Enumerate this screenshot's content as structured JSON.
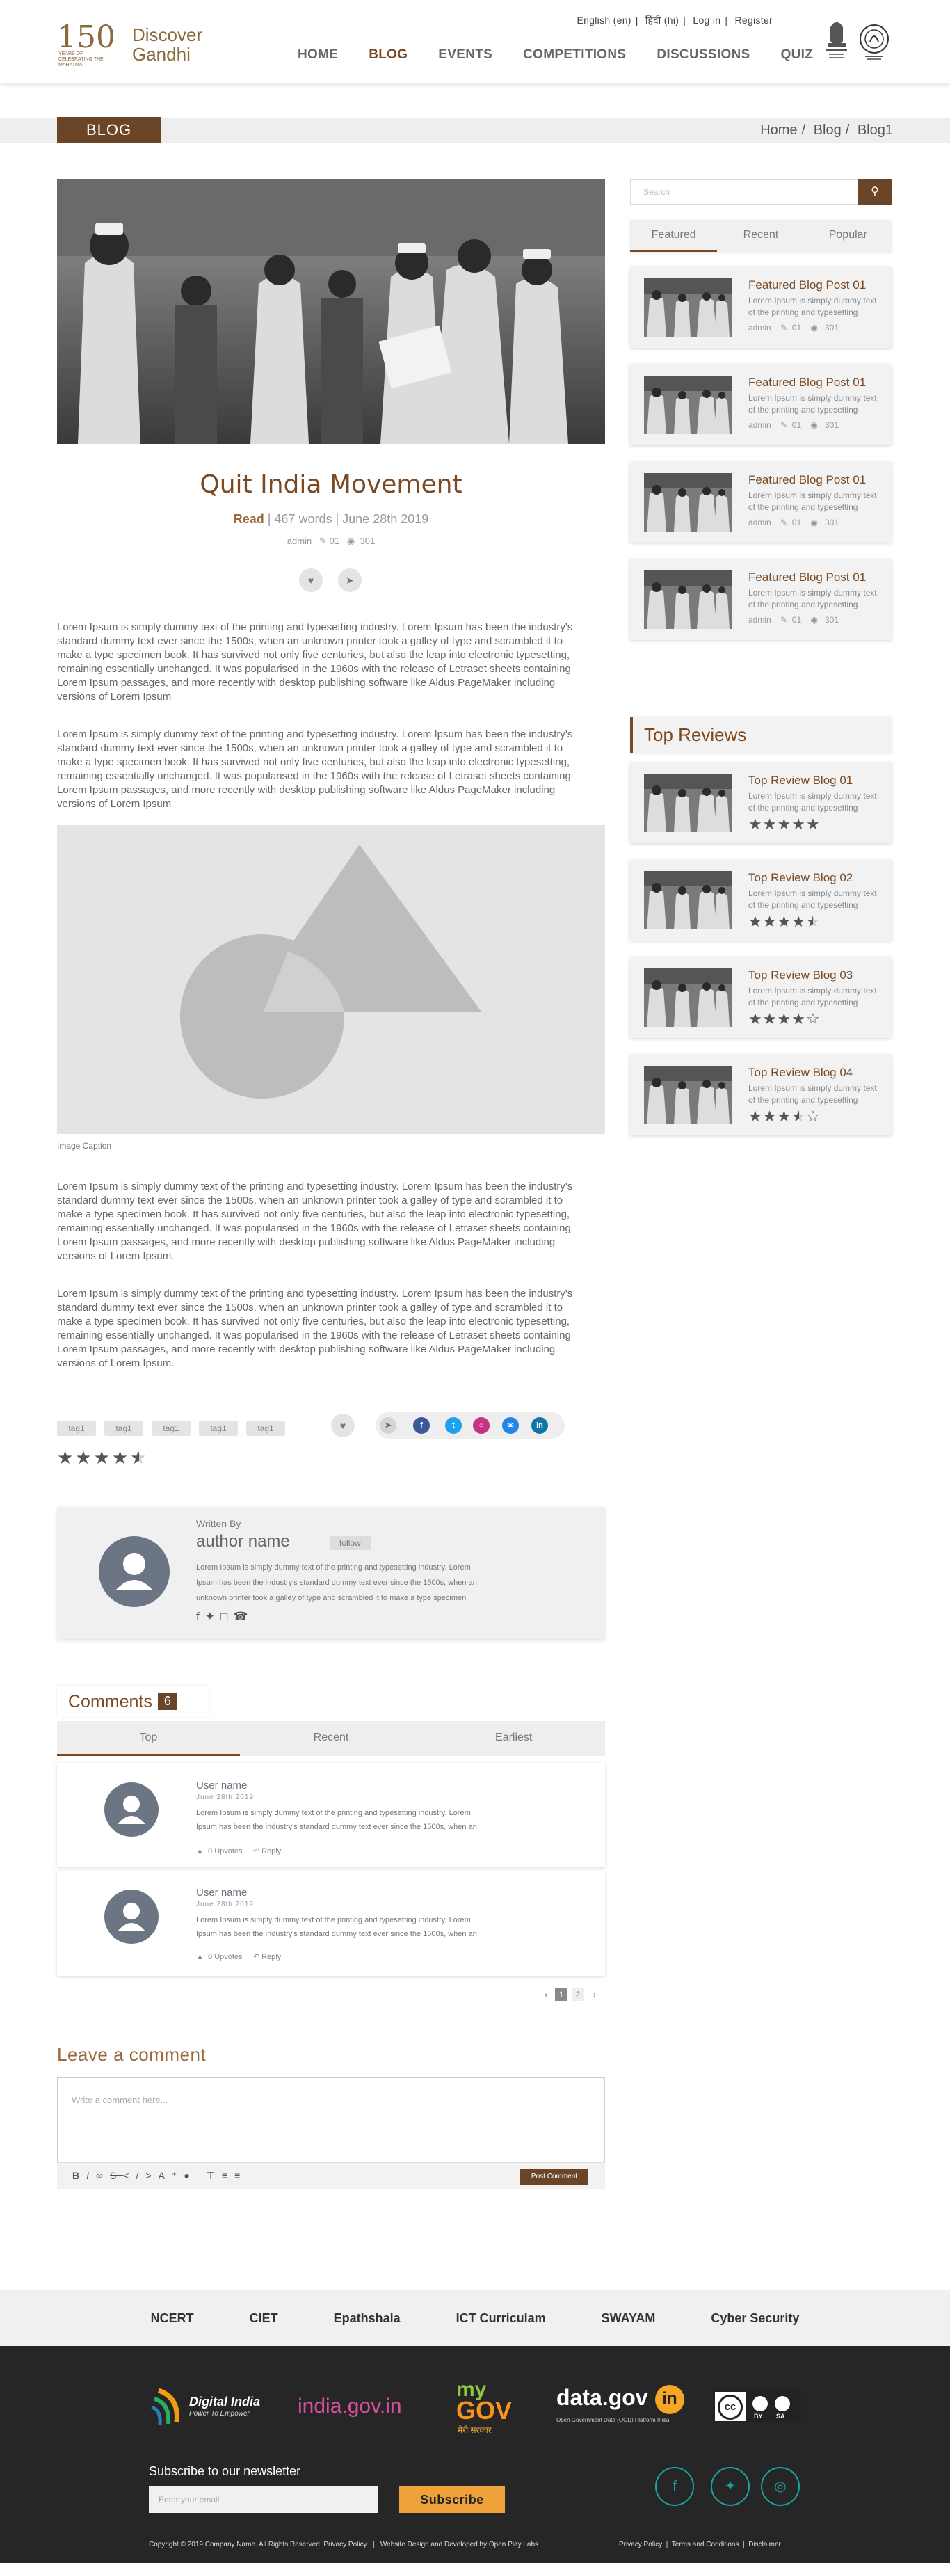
{
  "header": {
    "language_en": "English (en)",
    "language_hi": "हिंदी (hi)",
    "login": "Log in",
    "register": "Register",
    "logo_number": "150",
    "logo_small": "YEARS OF CELEBRATING THE MAHATMA",
    "logo_line1": "Discover",
    "logo_line2": "Gandhi",
    "nav": [
      "HOME",
      "BLOG",
      "EVENTS",
      "COMPETITIONS",
      "DISCUSSIONS",
      "QUIZ"
    ],
    "active_nav": "BLOG"
  },
  "banner": {
    "tag": "BLOG",
    "breadcrumb": [
      "Home",
      "Blog",
      "Blog1"
    ]
  },
  "article": {
    "title": "Quit India Movement",
    "read_label": "Read",
    "words": "467 words",
    "date": "June 28th 2019",
    "author": "admin",
    "comments": "01",
    "views": "301",
    "paragraph": "Lorem Ipsum is simply dummy text of the printing and typesetting industry. Lorem Ipsum has been the industry's standard dummy text ever since the 1500s, when an unknown printer took a galley of type and scrambled it to make a type specimen book. It has survived not only five centuries, but also the leap into electronic typesetting, remaining essentially unchanged. It was popularised in the 1960s with the release of Letraset sheets containing Lorem Ipsum passages, and more recently with desktop publishing software like Aldus PageMaker including versions of Lorem Ipsum",
    "paragraph_dot": "Lorem Ipsum is simply dummy text of the printing and typesetting industry. Lorem Ipsum has been the industry's standard dummy text ever since the 1500s, when an unknown printer took a galley of type and scrambled it to make a type specimen book. It has survived not only five centuries, but also the leap into electronic typesetting, remaining essentially unchanged. It was popularised in the 1960s with the release of Letraset sheets containing Lorem Ipsum passages, and more recently with desktop publishing software like Aldus PageMaker including versions of Lorem Ipsum.",
    "image_caption": "Image Caption",
    "tags": [
      "tag1",
      "tag1",
      "tag1",
      "tag1",
      "tag1"
    ],
    "rating": 4.5
  },
  "author_box": {
    "written_by": "Written By",
    "name": "author name",
    "follow": "follow",
    "bio_lines": [
      "Lorem Ipsum is simply dummy text of the printing and typesetting industry. Lorem",
      "Ipsum has been the industry's standard dummy text ever since the 1500s, when an",
      "unknown printer took a galley of type and scrambled it to make a type specimen"
    ]
  },
  "comments": {
    "heading": "Comments",
    "count": "6",
    "tabs": [
      "Top",
      "Recent",
      "Earliest"
    ],
    "items": [
      {
        "user": "User name",
        "date": "June 28th 2019",
        "text1": "Lorem Ipsum is simply dummy text of the printing and typesetting industry. Lorem",
        "text2": "Ipsum has been the industry's standard dummy text ever since the 1500s, when an",
        "upvotes": "0 Upvotes",
        "reply": "Reply"
      },
      {
        "user": "User name",
        "date": "June 28th 2019",
        "text1": "Lorem Ipsum is simply dummy text of the printing and typesetting industry. Lorem",
        "text2": "Ipsum has been the industry's standard dummy text ever since the 1500s, when an",
        "upvotes": "0 Upvotes",
        "reply": "Reply"
      }
    ],
    "pages": [
      "1",
      "2"
    ]
  },
  "leave_comment": {
    "heading": "Leave a comment",
    "placeholder": "Write a comment here...",
    "post_button": "Post Comment"
  },
  "sidebar": {
    "search_placeholder": "Search",
    "tabs": [
      "Featured",
      "Recent",
      "Popular"
    ],
    "featured": [
      {
        "title": "Featured Blog Post 01",
        "desc": "Lorem Ipsum is simply dummy text of the printing and typesetting",
        "author": "admin",
        "comments": "01",
        "views": "301"
      },
      {
        "title": "Featured Blog Post 01",
        "desc": "Lorem Ipsum is simply dummy text of the printing and typesetting",
        "author": "admin",
        "comments": "01",
        "views": "301"
      },
      {
        "title": "Featured Blog Post 01",
        "desc": "Lorem Ipsum is simply dummy text of the printing and typesetting",
        "author": "admin",
        "comments": "01",
        "views": "301"
      },
      {
        "title": "Featured Blog Post 01",
        "desc": "Lorem Ipsum is simply dummy text of the printing and typesetting",
        "author": "admin",
        "comments": "01",
        "views": "301"
      }
    ],
    "top_reviews_heading": "Top Reviews",
    "reviews": [
      {
        "title": "Top Review Blog 01",
        "desc": "Lorem Ipsum is simply dummy text of the printing and typesetting",
        "rating": 5
      },
      {
        "title": "Top Review Blog 02",
        "desc": "Lorem Ipsum is simply dummy text of the printing and typesetting",
        "rating": 4.5
      },
      {
        "title": "Top Review Blog 03",
        "desc": "Lorem Ipsum is simply dummy text of the printing and typesetting",
        "rating": 4
      },
      {
        "title": "Top Review Blog 04",
        "desc": "Lorem Ipsum is simply dummy text of the printing and typesetting",
        "rating": 3.5
      }
    ]
  },
  "footer": {
    "links": [
      "NCERT",
      "CIET",
      "Epathshala",
      "ICT Curriculam",
      "SWAYAM",
      "Cyber Security"
    ],
    "partners": {
      "digital_india": "Digital India",
      "digital_india_tag": "Power To Empower",
      "india_gov": "india.gov.in",
      "mygov_my": "my",
      "mygov_gov": "GOV",
      "mygov_hi": "मेरी सरकार",
      "data_gov": "data.gov",
      "data_gov_in": "in",
      "data_gov_tag": "Open Government Data (OGD) Platform India",
      "cc": "cc",
      "cc_by": "BY",
      "cc_sa": "SA"
    },
    "newsletter_heading": "Subscribe to our newsletter",
    "email_placeholder": "Enter your email",
    "subscribe": "Subscribe",
    "copyright": "Copyright © 2019 Company Name. All Rights Reserved. Privacy Policy   |   Website Design and Developed by Open Play Labs",
    "legal": "Privacy Policy  |  Terms and Conditions  |  Disclaimer"
  },
  "colors": {
    "brand": "#7b4a23",
    "brand_dark": "#6a4527",
    "accent": "#f0a23a",
    "footer_bg": "#262626"
  }
}
